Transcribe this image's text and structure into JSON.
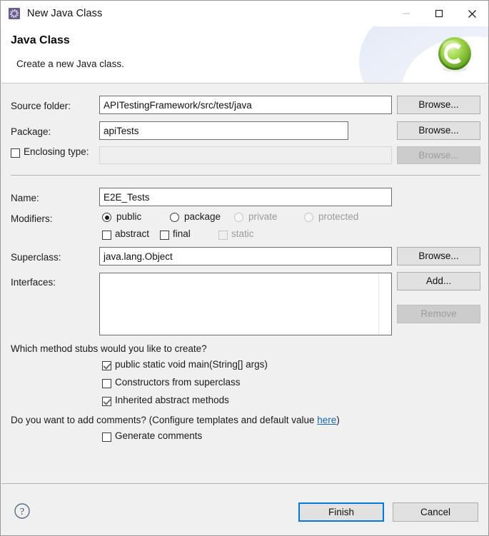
{
  "window": {
    "title": "New Java Class",
    "icon": "eclipse-wizard-icon",
    "controls": {
      "minimize": "minimize-icon",
      "maximize": "maximize-icon",
      "close": "close-icon"
    }
  },
  "header": {
    "title": "Java Class",
    "subtitle": "Create a new Java class.",
    "logo": "java-class-green-c-icon"
  },
  "form": {
    "source_folder": {
      "label": "Source folder:",
      "value": "APITestingFramework/src/test/java",
      "browse_label": "Browse..."
    },
    "package": {
      "label": "Package:",
      "value": "apiTests",
      "browse_label": "Browse..."
    },
    "enclosing_type": {
      "label": "Enclosing type:",
      "checked": false,
      "value": "",
      "browse_label": "Browse...",
      "disabled": true
    },
    "name": {
      "label": "Name:",
      "value": "E2E_Tests"
    },
    "modifiers": {
      "label": "Modifiers:",
      "radios": [
        {
          "label": "public",
          "checked": true,
          "disabled": false
        },
        {
          "label": "package",
          "checked": false,
          "disabled": false
        },
        {
          "label": "private",
          "checked": false,
          "disabled": true
        },
        {
          "label": "protected",
          "checked": false,
          "disabled": true
        }
      ],
      "checkboxes": [
        {
          "label": "abstract",
          "checked": false,
          "disabled": false
        },
        {
          "label": "final",
          "checked": false,
          "disabled": false
        },
        {
          "label": "static",
          "checked": false,
          "disabled": true
        }
      ]
    },
    "superclass": {
      "label": "Superclass:",
      "value": "java.lang.Object",
      "browse_label": "Browse..."
    },
    "interfaces": {
      "label": "Interfaces:",
      "items": [],
      "add_label": "Add...",
      "remove_label": "Remove",
      "remove_disabled": true
    }
  },
  "stubs": {
    "question": "Which method stubs would you like to create?",
    "options": [
      {
        "label": "public static void main(String[] args)",
        "checked": true
      },
      {
        "label": "Constructors from superclass",
        "checked": false
      },
      {
        "label": "Inherited abstract methods",
        "checked": true
      }
    ]
  },
  "comments": {
    "question_prefix": "Do you want to add comments? (Configure templates and default value ",
    "link": "here",
    "question_suffix": ")",
    "option": {
      "label": "Generate comments",
      "checked": false
    }
  },
  "footer": {
    "help": "help-icon",
    "finish_label": "Finish",
    "cancel_label": "Cancel"
  },
  "colors": {
    "accent": "#0078d7",
    "link": "#1763b8",
    "dialog_bg": "#f0f0f0",
    "logo_green": "#7ac943"
  }
}
